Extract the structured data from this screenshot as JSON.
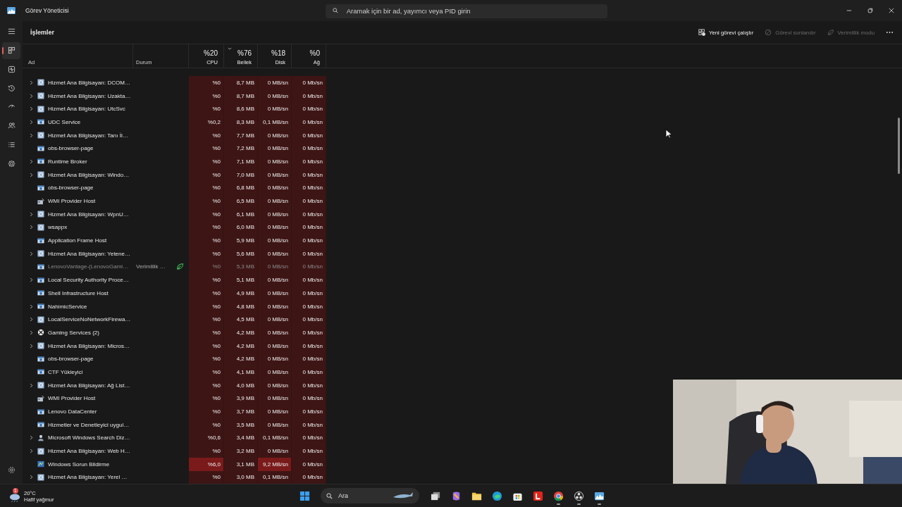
{
  "window": {
    "title": "Görev Yöneticisi",
    "search_placeholder": "Aramak için bir ad, yayımcı veya PID girin"
  },
  "sidebar": {
    "items": [
      {
        "kind": "processes",
        "selected": true
      },
      {
        "kind": "performance",
        "selected": false
      },
      {
        "kind": "history",
        "selected": false
      },
      {
        "kind": "startup",
        "selected": false
      },
      {
        "kind": "users",
        "selected": false
      },
      {
        "kind": "details",
        "selected": false
      },
      {
        "kind": "services",
        "selected": false
      }
    ]
  },
  "page_title": "İşlemler",
  "toolbar": [
    {
      "label": "Yeni görevi çalıştır",
      "kind": "run",
      "disabled": false
    },
    {
      "label": "Görevi sonlandır",
      "kind": "end",
      "disabled": true
    },
    {
      "label": "Verimlilik modu",
      "kind": "eco",
      "disabled": true
    }
  ],
  "columns": [
    {
      "label": "Ad"
    },
    {
      "label": "Durum"
    },
    {
      "total": "%20",
      "label": "CPU",
      "sorted": false
    },
    {
      "total": "%76",
      "label": "Bellek",
      "sorted": true
    },
    {
      "total": "%18",
      "label": "Disk",
      "sorted": false
    },
    {
      "total": "%0",
      "label": "Ağ",
      "sorted": false
    }
  ],
  "rows": [
    {
      "name": "Hizmet Ana Bilgisayarı: DCOM…",
      "expandable": true,
      "kind": "service",
      "efficiency_mode": false,
      "cpu": "%0",
      "cpu_hot": false,
      "memory": "8,7 MB",
      "disk": "0 MB/sn",
      "disk_hot": false,
      "network": "0 Mb/sn"
    },
    {
      "name": "Hizmet Ana Bilgisayarı: Uzakta…",
      "expandable": true,
      "kind": "service",
      "efficiency_mode": false,
      "cpu": "%0",
      "cpu_hot": false,
      "memory": "8,7 MB",
      "disk": "0 MB/sn",
      "disk_hot": false,
      "network": "0 Mb/sn"
    },
    {
      "name": "Hizmet Ana Bilgisayarı: UtcSvc",
      "expandable": true,
      "kind": "service",
      "efficiency_mode": false,
      "cpu": "%0",
      "cpu_hot": false,
      "memory": "8,6 MB",
      "disk": "0 MB/sn",
      "disk_hot": false,
      "network": "0 Mb/sn"
    },
    {
      "name": "UDC Service",
      "expandable": true,
      "kind": "app",
      "efficiency_mode": false,
      "cpu": "%0,2",
      "cpu_hot": false,
      "memory": "8,3 MB",
      "disk": "0,1 MB/sn",
      "disk_hot": false,
      "network": "0 Mb/sn"
    },
    {
      "name": "Hizmet Ana Bilgisayarı: Tanı İl…",
      "expandable": true,
      "kind": "service",
      "efficiency_mode": false,
      "cpu": "%0",
      "cpu_hot": false,
      "memory": "7,7 MB",
      "disk": "0 MB/sn",
      "disk_hot": false,
      "network": "0 Mb/sn"
    },
    {
      "name": "obs-browser-page",
      "expandable": false,
      "kind": "app",
      "efficiency_mode": false,
      "cpu": "%0",
      "cpu_hot": false,
      "memory": "7,2 MB",
      "disk": "0 MB/sn",
      "disk_hot": false,
      "network": "0 Mb/sn"
    },
    {
      "name": "Runtime Broker",
      "expandable": true,
      "kind": "app",
      "efficiency_mode": false,
      "cpu": "%0",
      "cpu_hot": false,
      "memory": "7,1 MB",
      "disk": "0 MB/sn",
      "disk_hot": false,
      "network": "0 Mb/sn"
    },
    {
      "name": "Hizmet Ana Bilgisayarı: Windo…",
      "expandable": true,
      "kind": "service",
      "efficiency_mode": false,
      "cpu": "%0",
      "cpu_hot": false,
      "memory": "7,0 MB",
      "disk": "0 MB/sn",
      "disk_hot": false,
      "network": "0 Mb/sn"
    },
    {
      "name": "obs-browser-page",
      "expandable": false,
      "kind": "app",
      "efficiency_mode": false,
      "cpu": "%0",
      "cpu_hot": false,
      "memory": "6,8 MB",
      "disk": "0 MB/sn",
      "disk_hot": false,
      "network": "0 Mb/sn"
    },
    {
      "name": "WMI Provider Host",
      "expandable": false,
      "kind": "wmi",
      "efficiency_mode": false,
      "cpu": "%0",
      "cpu_hot": false,
      "memory": "6,5 MB",
      "disk": "0 MB/sn",
      "disk_hot": false,
      "network": "0 Mb/sn"
    },
    {
      "name": "Hizmet Ana Bilgisayarı: WpnU…",
      "expandable": true,
      "kind": "service",
      "efficiency_mode": false,
      "cpu": "%0",
      "cpu_hot": false,
      "memory": "6,1 MB",
      "disk": "0 MB/sn",
      "disk_hot": false,
      "network": "0 Mb/sn"
    },
    {
      "name": "wsappx",
      "expandable": true,
      "kind": "service",
      "efficiency_mode": false,
      "cpu": "%0",
      "cpu_hot": false,
      "memory": "6,0 MB",
      "disk": "0 MB/sn",
      "disk_hot": false,
      "network": "0 Mb/sn"
    },
    {
      "name": "Application Frame Host",
      "expandable": false,
      "kind": "app",
      "efficiency_mode": false,
      "cpu": "%0",
      "cpu_hot": false,
      "memory": "5,9 MB",
      "disk": "0 MB/sn",
      "disk_hot": false,
      "network": "0 Mb/sn"
    },
    {
      "name": "Hizmet Ana Bilgisayarı: Yetene…",
      "expandable": true,
      "kind": "service",
      "efficiency_mode": false,
      "cpu": "%0",
      "cpu_hot": false,
      "memory": "5,6 MB",
      "disk": "0 MB/sn",
      "disk_hot": false,
      "network": "0 Mb/sn"
    },
    {
      "name": "LenovoVantage-(LenovoGami…",
      "expandable": false,
      "kind": "app",
      "status": "Verimlilik …",
      "efficiency_mode": true,
      "cpu": "%0",
      "cpu_hot": false,
      "memory": "5,3 MB",
      "disk": "0 MB/sn",
      "disk_hot": false,
      "network": "0 Mb/sn"
    },
    {
      "name": "Local Security Authority Proce…",
      "expandable": true,
      "kind": "app",
      "efficiency_mode": false,
      "cpu": "%0",
      "cpu_hot": false,
      "memory": "5,1 MB",
      "disk": "0 MB/sn",
      "disk_hot": false,
      "network": "0 Mb/sn"
    },
    {
      "name": "Shell Infrastructure Host",
      "expandable": false,
      "kind": "app",
      "efficiency_mode": false,
      "cpu": "%0",
      "cpu_hot": false,
      "memory": "4,9 MB",
      "disk": "0 MB/sn",
      "disk_hot": false,
      "network": "0 Mb/sn"
    },
    {
      "name": "NahimicService",
      "expandable": true,
      "kind": "app",
      "efficiency_mode": false,
      "cpu": "%0",
      "cpu_hot": false,
      "memory": "4,8 MB",
      "disk": "0 MB/sn",
      "disk_hot": false,
      "network": "0 Mb/sn"
    },
    {
      "name": "LocalServiceNoNetworkFirewa…",
      "expandable": true,
      "kind": "service",
      "efficiency_mode": false,
      "cpu": "%0",
      "cpu_hot": false,
      "memory": "4,5 MB",
      "disk": "0 MB/sn",
      "disk_hot": false,
      "network": "0 Mb/sn"
    },
    {
      "name": "Gaming Services (2)",
      "expandable": true,
      "kind": "xbox",
      "efficiency_mode": false,
      "cpu": "%0",
      "cpu_hot": false,
      "memory": "4,2 MB",
      "disk": "0 MB/sn",
      "disk_hot": false,
      "network": "0 Mb/sn"
    },
    {
      "name": "Hizmet Ana Bilgisayarı: Micros…",
      "expandable": true,
      "kind": "service",
      "efficiency_mode": false,
      "cpu": "%0",
      "cpu_hot": false,
      "memory": "4,2 MB",
      "disk": "0 MB/sn",
      "disk_hot": false,
      "network": "0 Mb/sn"
    },
    {
      "name": "obs-browser-page",
      "expandable": false,
      "kind": "app",
      "efficiency_mode": false,
      "cpu": "%0",
      "cpu_hot": false,
      "memory": "4,2 MB",
      "disk": "0 MB/sn",
      "disk_hot": false,
      "network": "0 Mb/sn"
    },
    {
      "name": "CTF Yükleyici",
      "expandable": false,
      "kind": "app",
      "efficiency_mode": false,
      "cpu": "%0",
      "cpu_hot": false,
      "memory": "4,1 MB",
      "disk": "0 MB/sn",
      "disk_hot": false,
      "network": "0 Mb/sn"
    },
    {
      "name": "Hizmet Ana Bilgisayarı: Ağ List…",
      "expandable": true,
      "kind": "service",
      "efficiency_mode": false,
      "cpu": "%0",
      "cpu_hot": false,
      "memory": "4,0 MB",
      "disk": "0 MB/sn",
      "disk_hot": false,
      "network": "0 Mb/sn"
    },
    {
      "name": "WMI Provider Host",
      "expandable": false,
      "kind": "wmi",
      "efficiency_mode": false,
      "cpu": "%0",
      "cpu_hot": false,
      "memory": "3,9 MB",
      "disk": "0 MB/sn",
      "disk_hot": false,
      "network": "0 Mb/sn"
    },
    {
      "name": "Lenovo DataCenter",
      "expandable": false,
      "kind": "app",
      "efficiency_mode": false,
      "cpu": "%0",
      "cpu_hot": false,
      "memory": "3,7 MB",
      "disk": "0 MB/sn",
      "disk_hot": false,
      "network": "0 Mb/sn"
    },
    {
      "name": "Hizmetler ve Denetleyici uygul…",
      "expandable": false,
      "kind": "app",
      "efficiency_mode": false,
      "cpu": "%0",
      "cpu_hot": false,
      "memory": "3,5 MB",
      "disk": "0 MB/sn",
      "disk_hot": false,
      "network": "0 Mb/sn"
    },
    {
      "name": "Microsoft Windows Search Diz…",
      "expandable": true,
      "kind": "search",
      "efficiency_mode": false,
      "cpu": "%0,6",
      "cpu_hot": false,
      "memory": "3,4 MB",
      "disk": "0,1 MB/sn",
      "disk_hot": false,
      "network": "0 Mb/sn"
    },
    {
      "name": "Hizmet Ana Bilgisayarı: Web H…",
      "expandable": true,
      "kind": "service",
      "efficiency_mode": false,
      "cpu": "%0",
      "cpu_hot": false,
      "memory": "3,2 MB",
      "disk": "0 MB/sn",
      "disk_hot": false,
      "network": "0 Mb/sn"
    },
    {
      "name": "Windows Sorun Bildirme",
      "expandable": false,
      "kind": "report",
      "efficiency_mode": false,
      "cpu": "%6,0",
      "cpu_hot": true,
      "memory": "3,1 MB",
      "disk": "9,2 MB/sn",
      "disk_hot": true,
      "network": "0 Mb/sn"
    },
    {
      "name": "Hizmet Ana Bilgisayarı: Yerel …",
      "expandable": true,
      "kind": "service",
      "efficiency_mode": false,
      "cpu": "%0",
      "cpu_hot": false,
      "memory": "3,0 MB",
      "disk": "0,1 MB/sn",
      "disk_hot": false,
      "network": "0 Mb/sn"
    }
  ],
  "taskbar": {
    "weather": {
      "temperature": "20°C",
      "condition": "Hafif yağmur",
      "badge": "1"
    },
    "search_placeholder": "Ara",
    "apps": [
      {
        "kind": "start",
        "active": false
      },
      {
        "kind": "taskview",
        "active": false
      },
      {
        "kind": "copilot",
        "active": false
      },
      {
        "kind": "files",
        "active": false
      },
      {
        "kind": "edge",
        "active": false
      },
      {
        "kind": "store",
        "active": false
      },
      {
        "kind": "lenovo",
        "active": false
      },
      {
        "kind": "chrome",
        "active": true
      },
      {
        "kind": "obs",
        "active": true
      },
      {
        "kind": "taskmgr",
        "active": true
      }
    ]
  }
}
